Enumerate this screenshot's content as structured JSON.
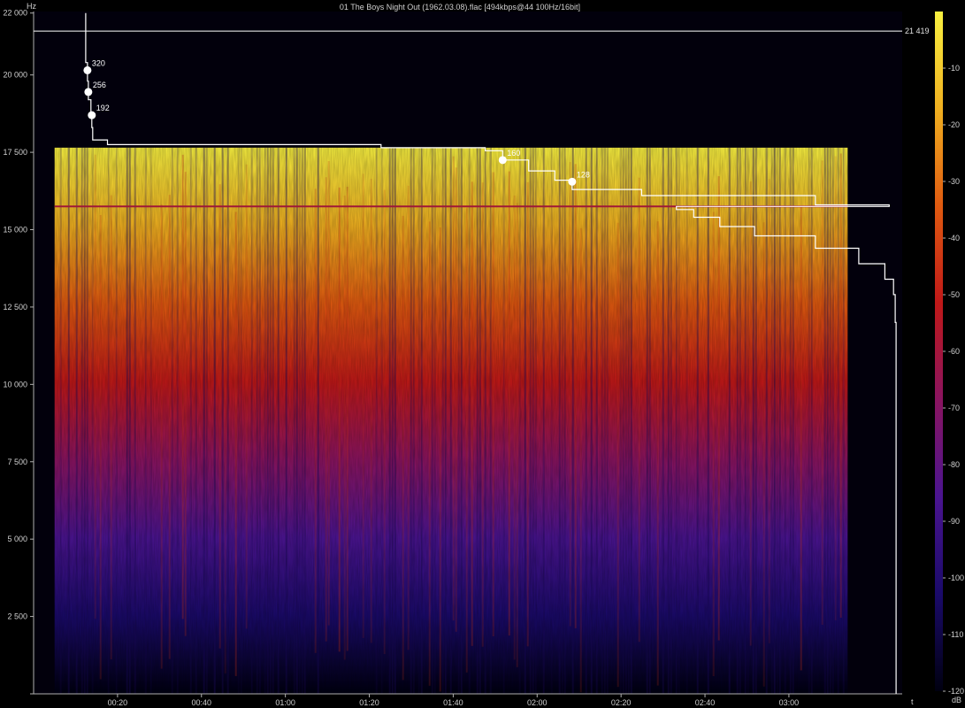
{
  "chart_data": {
    "type": "heatmap",
    "title": "01 The Boys Night Out (1962.03.08).flac [494kbps@44 100Hz/16bit]",
    "ylabel": "Hz",
    "xlabel": "t",
    "colorbar_label": "dB",
    "ylim": [
      0,
      22050
    ],
    "xlim_seconds": [
      0,
      207
    ],
    "y_ticks": [
      {
        "value": 0,
        "label": ""
      },
      {
        "value": 2500,
        "label": "2 500"
      },
      {
        "value": 5000,
        "label": "5 000"
      },
      {
        "value": 7500,
        "label": "7 500"
      },
      {
        "value": 10000,
        "label": "10 000"
      },
      {
        "value": 12500,
        "label": "12 500"
      },
      {
        "value": 15000,
        "label": "15 000"
      },
      {
        "value": 17500,
        "label": "17 500"
      },
      {
        "value": 20000,
        "label": "20 000"
      },
      {
        "value": 22000,
        "label": "22 000"
      }
    ],
    "x_ticks": [
      {
        "value": 20,
        "label": "00:20"
      },
      {
        "value": 40,
        "label": "00:40"
      },
      {
        "value": 60,
        "label": "01:00"
      },
      {
        "value": 80,
        "label": "01:20"
      },
      {
        "value": 100,
        "label": "01:40"
      },
      {
        "value": 120,
        "label": "02:00"
      },
      {
        "value": 140,
        "label": "02:20"
      },
      {
        "value": 160,
        "label": "02:40"
      },
      {
        "value": 180,
        "label": "03:00"
      }
    ],
    "colorbar_ticks": [
      -10,
      -20,
      -30,
      -40,
      -50,
      -60,
      -70,
      -80,
      -90,
      -100,
      -110,
      -120
    ],
    "colorbar_range": [
      -120,
      0
    ],
    "colors": {
      "stops": [
        "#000010",
        "#1a0a6a",
        "#4a1490",
        "#8a1460",
        "#c01818",
        "#e05a10",
        "#f0b020",
        "#f8f040"
      ],
      "background": "#000000",
      "curve": "#ffffff",
      "axis": "#b0b0b0"
    },
    "content": {
      "signal_start_s": 5,
      "signal_end_s": 194,
      "lowpass_cutoff_hz": 17650,
      "hum_line_hz": 15750
    },
    "cutoff_line": {
      "value": 21419,
      "label": "21 419"
    },
    "bitrate_markers": [
      {
        "label": "320",
        "hz": 20150
      },
      {
        "label": "256",
        "hz": 19450
      },
      {
        "label": "192",
        "hz": 18700
      },
      {
        "label": "160",
        "hz": 17250
      },
      {
        "label": "128",
        "hz": 16550
      }
    ],
    "frequency_profile": [
      {
        "hz": 22000,
        "x": 0.06
      },
      {
        "hz": 21600,
        "x": 0.06
      },
      {
        "hz": 21000,
        "x": 0.06
      },
      {
        "hz": 20400,
        "x": 0.06
      },
      {
        "hz": 19800,
        "x": 0.062
      },
      {
        "hz": 19200,
        "x": 0.063
      },
      {
        "hz": 18800,
        "x": 0.066
      },
      {
        "hz": 18300,
        "x": 0.067
      },
      {
        "hz": 17900,
        "x": 0.068
      },
      {
        "hz": 17750,
        "x": 0.085
      },
      {
        "hz": 17650,
        "x": 0.4
      },
      {
        "hz": 17550,
        "x": 0.52
      },
      {
        "hz": 17250,
        "x": 0.54
      },
      {
        "hz": 16900,
        "x": 0.57
      },
      {
        "hz": 16600,
        "x": 0.6
      },
      {
        "hz": 16300,
        "x": 0.62
      },
      {
        "hz": 16100,
        "x": 0.7
      },
      {
        "hz": 15800,
        "x": 0.9
      },
      {
        "hz": 15750,
        "x": 0.985
      },
      {
        "hz": 15650,
        "x": 0.74
      },
      {
        "hz": 15400,
        "x": 0.76
      },
      {
        "hz": 15100,
        "x": 0.79
      },
      {
        "hz": 14800,
        "x": 0.83
      },
      {
        "hz": 14400,
        "x": 0.9
      },
      {
        "hz": 13900,
        "x": 0.95
      },
      {
        "hz": 13400,
        "x": 0.98
      },
      {
        "hz": 12900,
        "x": 0.99
      },
      {
        "hz": 12000,
        "x": 0.992
      },
      {
        "hz": 6000,
        "x": 0.993
      },
      {
        "hz": 1000,
        "x": 0.993
      },
      {
        "hz": 0,
        "x": 0.993
      }
    ]
  }
}
